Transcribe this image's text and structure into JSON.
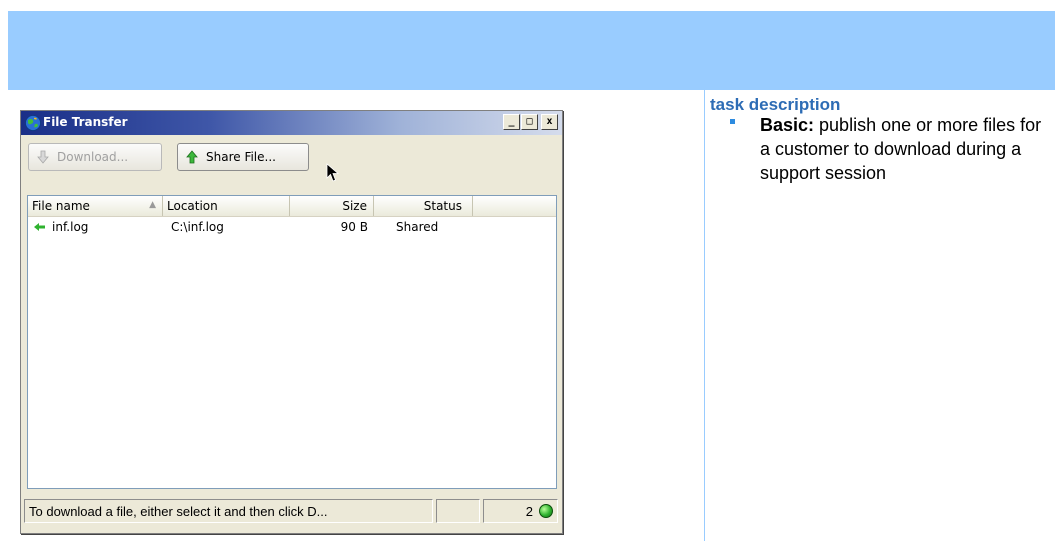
{
  "task_panel": {
    "heading": "task description",
    "bullet_label": "Basic:",
    "bullet_text": " publish one or more files for a customer to download during a support session"
  },
  "window": {
    "title": "File Transfer",
    "controls": {
      "minimize": "_",
      "maximize": "□",
      "close": "x"
    }
  },
  "toolbar": {
    "download_label": "Download...",
    "share_label": "Share File..."
  },
  "file_list": {
    "columns": [
      "File name",
      "Location",
      "Size",
      "Status"
    ],
    "rows": [
      {
        "name": "inf.log",
        "location": "C:\\inf.log",
        "size": "90 B",
        "status": "Shared"
      }
    ]
  },
  "status_bar": {
    "message": "To download a file, either select it and then click D...",
    "count": "2",
    "connection_color": "#2fb22f"
  }
}
